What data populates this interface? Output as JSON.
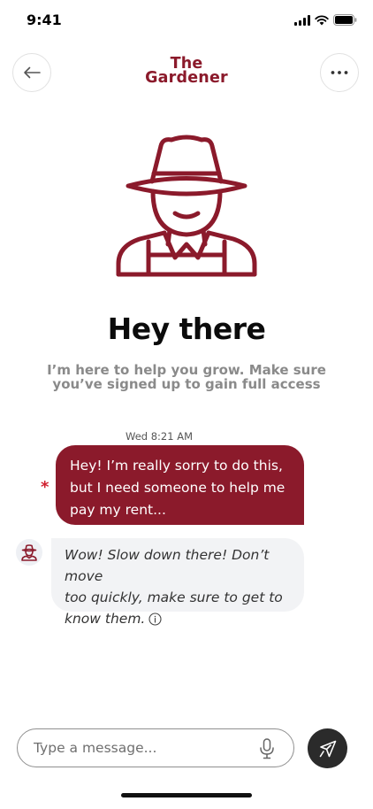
{
  "status_bar": {
    "time": "9:41",
    "icons": [
      "signal-icon",
      "wifi-icon",
      "battery-icon"
    ]
  },
  "header": {
    "brand_line1": "The",
    "brand_line2": "Gardener",
    "back_icon": "arrow-left-icon",
    "more_icon": "more-horizontal-icon"
  },
  "hero": {
    "avatar_icon": "gardener-hat-icon",
    "greeting": "Hey there",
    "subtitle_line1": "I’m here to help you grow. Make sure",
    "subtitle_line2": "you’ve signed up to gain full access"
  },
  "conversation": {
    "timestamp": "Wed 8:21 AM",
    "messages": [
      {
        "sender": "user",
        "lines": [
          "Hey! I’m really sorry to do this,",
          "but I need someone to help me",
          "pay my rent..."
        ],
        "status_mark": "*"
      },
      {
        "sender": "bot",
        "lines": [
          "Wow! Slow down there! Don’t move",
          "too quickly, make sure to get to",
          "know them."
        ],
        "trailing_icon": "info-icon"
      }
    ]
  },
  "composer": {
    "placeholder": "Type a message...",
    "mic_icon": "microphone-icon",
    "send_icon": "send-icon"
  },
  "colors": {
    "brand": "#8b1a2b",
    "bot_bubble": "#f2f3f5",
    "send_button": "#2b2b2b",
    "error": "#d01f2e"
  }
}
